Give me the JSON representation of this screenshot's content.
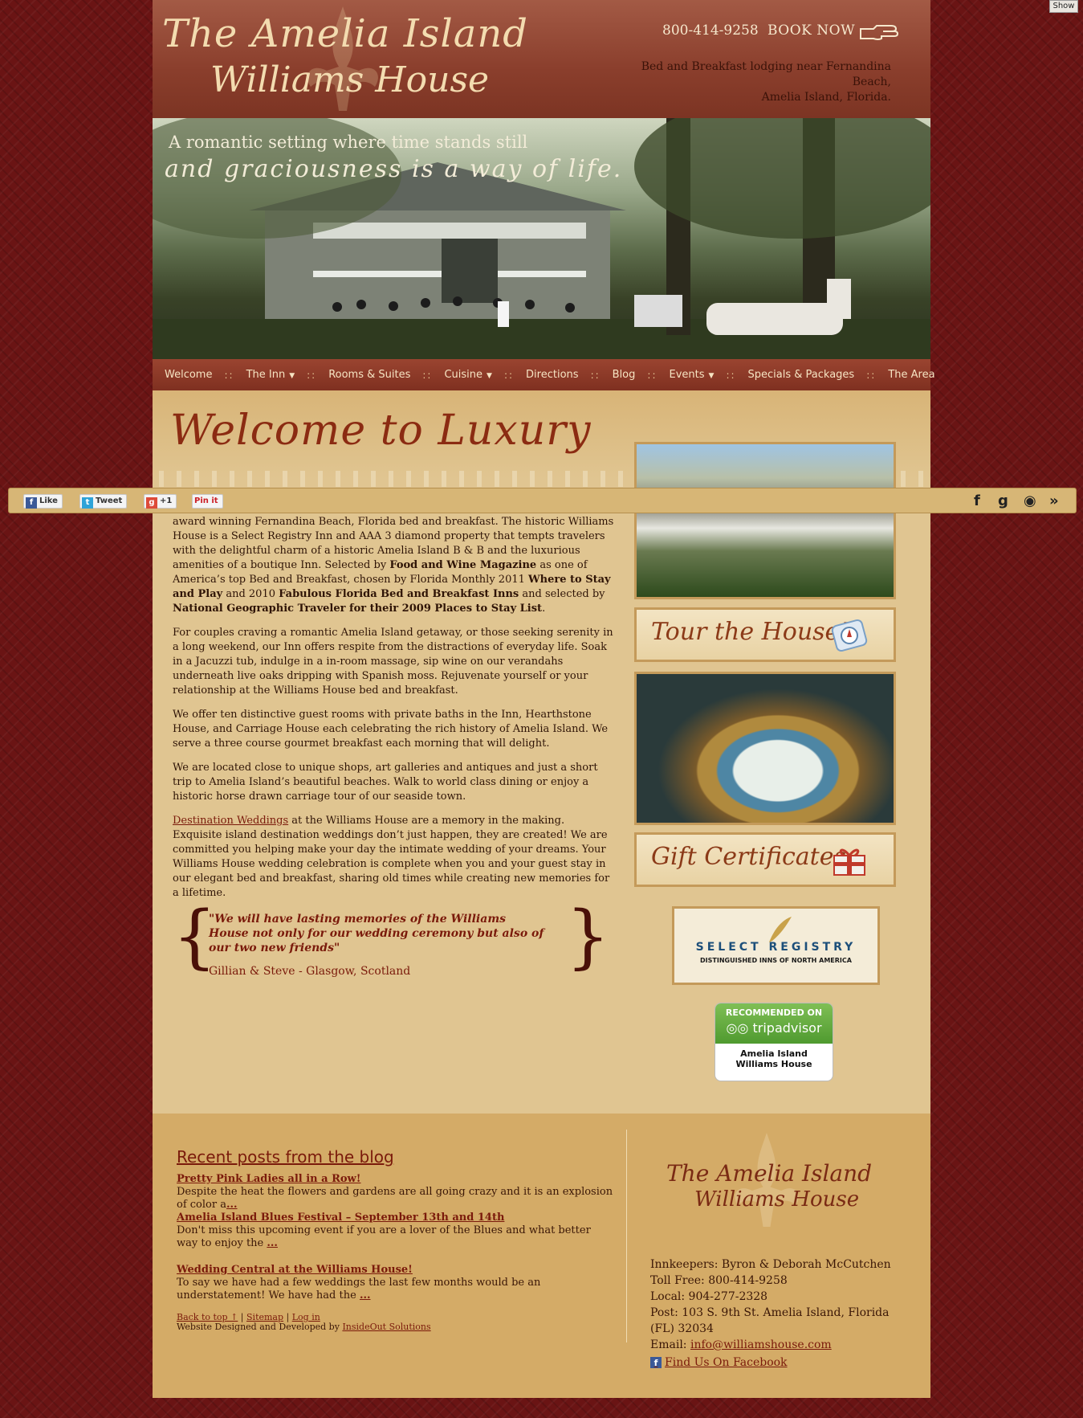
{
  "show_button": "Show",
  "header": {
    "logo_line1": "The Amelia Island",
    "logo_line2": "Williams House",
    "phone": "800-414-9258",
    "book_now": "BOOK NOW",
    "tagline_line1": "Bed and Breakfast lodging near Fernandina Beach,",
    "tagline_line2": "Amelia Island, Florida."
  },
  "hero": {
    "line1": "A romantic setting where time stands still",
    "line2": "and graciousness is a way of life."
  },
  "nav": {
    "items": [
      {
        "label": "Welcome"
      },
      {
        "label": "The Inn",
        "caret": "▼"
      },
      {
        "label": "Rooms & Suites"
      },
      {
        "label": "Cuisine",
        "caret": "▼"
      },
      {
        "label": "Directions"
      },
      {
        "label": "Blog"
      },
      {
        "label": "Events",
        "caret": "▼"
      },
      {
        "label": "Specials & Packages"
      },
      {
        "label": "The Area"
      }
    ],
    "separator": "::"
  },
  "main": {
    "title": "Welcome to Luxury",
    "p1_a": "award winning Fernandina Beach, Florida bed and breakfast. The historic Williams House is a Select Registry Inn and AAA 3 diamond property that tempts travelers with the delightful charm of a historic Amelia Island B & B and the luxurious amenities of a boutique Inn. Selected by ",
    "p1_b": "Food and Wine Magazine",
    "p1_c": " as one of America’s top Bed and Breakfast, chosen by Florida Monthly 2011 ",
    "p1_d": "Where to Stay and Play",
    "p1_e": " and 2010 ",
    "p1_f": "Fabulous Florida Bed and Breakfast Inns",
    "p1_g": " and selected by ",
    "p1_h": "National Geographic Traveler for their 2009 Places to Stay List",
    "p1_i": ".",
    "p2": "For couples craving a romantic Amelia Island getaway, or those seeking serenity in a long weekend, our Inn offers respite from the distractions of everyday life. Soak in a Jacuzzi tub, indulge in a in-room massage, sip wine on our verandahs underneath live oaks dripping with Spanish moss. Rejuvenate yourself or your relationship at the Williams House bed and breakfast.",
    "p3": "We offer ten distinctive guest rooms with private baths in the Inn, Hearthstone House, and Carriage House each celebrating the rich history of Amelia Island. We serve a three course gourmet breakfast each morning that will delight.",
    "p4": "We are located close to unique shops, art galleries and antiques and just a short trip to Amelia Island’s beautiful beaches. Walk to world class dining or enjoy a historic horse drawn carriage tour of our seaside town.",
    "p5_link": "Destination Weddings",
    "p5_rest": " at the Williams House are a memory in the making. Exquisite island destination weddings don’t just happen, they are created! We are committed you helping make your day the intimate wedding of your dreams. Your Williams House wedding celebration is complete when you and your guest stay in our elegant bed and breakfast, sharing old times while creating new memories for a lifetime.",
    "quote": "\"We will have lasting memories of the Williams House not only for our wedding ceremony but also of our two new friends\"",
    "quote_by": "Gillian & Steve - Glasgow, Scotland",
    "brace_open": "{",
    "brace_close": "}"
  },
  "sidebar": {
    "tour": "Tour the House!",
    "gift": "Gift Certificates",
    "select_registry": "SELECT REGISTRY",
    "select_registry_sub": "DISTINGUISHED INNS OF NORTH AMERICA",
    "trip_recommended": "RECOMMENDED ON",
    "trip_brand": "tripadvisor",
    "trip_name_1": "Amelia Island",
    "trip_name_2": "Williams House"
  },
  "sharebar": {
    "like": "Like",
    "tweet": "Tweet",
    "plus": "+1",
    "pin": "Pin it",
    "facebook": "f",
    "gplus": "g",
    "rss": "◉",
    "more": "»"
  },
  "footer": {
    "blog_heading": "Recent posts from the blog",
    "posts": [
      {
        "title": "Pretty Pink Ladies all in a Row!",
        "excerpt": " Despite the heat the flowers and gardens are all going crazy and it is an explosion of color a",
        "more": "..."
      },
      {
        "title": "Amelia Island Blues Festival – September 13th and 14th",
        "excerpt": "Don't miss this upcoming event if you are a lover of the Blues and what better way to enjoy the ",
        "more": "..."
      },
      {
        "title": "Wedding Central at the Williams House!",
        "excerpt": "To say we have had a few weddings the last few months would be an understatement!  We have had the ",
        "more": "..."
      }
    ],
    "back_to_top": "Back to top ↑",
    "sitemap": "Sitemap",
    "login": "Log in",
    "sep": " | ",
    "designed_by": "Website Designed and Developed by ",
    "designer": "InsideOut Solutions",
    "logo_line1": "The Amelia Island",
    "logo_line2": "Williams House",
    "innkeepers": "Innkeepers: Byron & Deborah McCutchen",
    "toll_free": "Toll Free: 800-414-9258",
    "local": "Local: 904-277-2328",
    "post": "Post: 103 S. 9th St. Amelia Island, Florida (FL) 32034",
    "email_label": "Email: ",
    "email": "info@williamshouse.com",
    "facebook": "Find Us On Facebook"
  }
}
